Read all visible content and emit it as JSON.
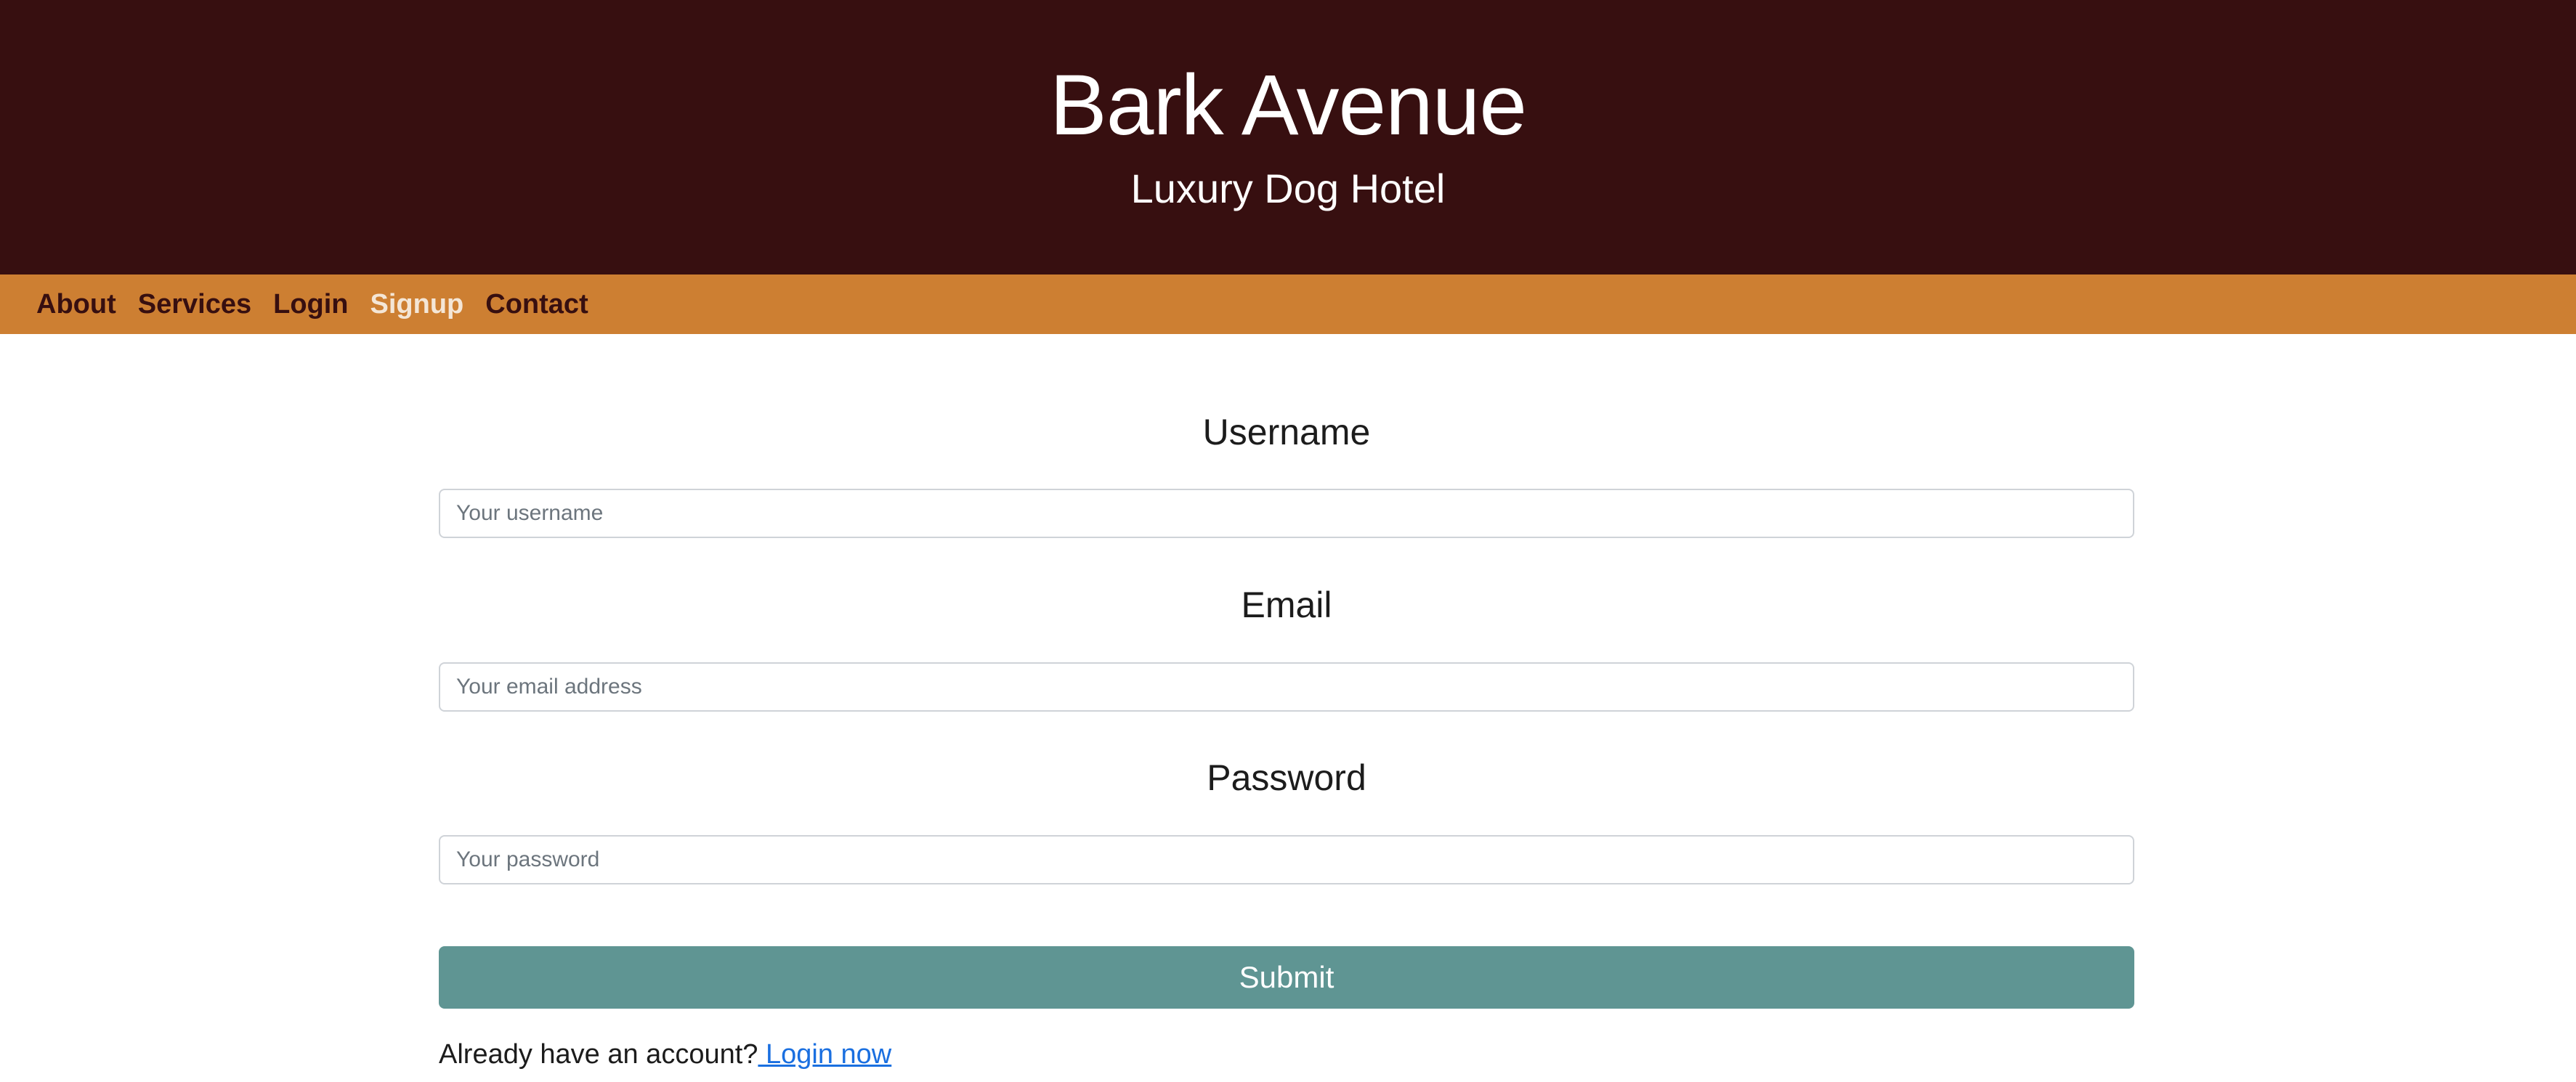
{
  "header": {
    "title": "Bark Avenue",
    "subtitle": "Luxury Dog Hotel"
  },
  "nav": {
    "items": [
      {
        "label": "About"
      },
      {
        "label": "Services"
      },
      {
        "label": "Login"
      },
      {
        "label": "Signup",
        "active": true
      },
      {
        "label": "Contact"
      }
    ]
  },
  "form": {
    "username": {
      "label": "Username",
      "placeholder": "Your username",
      "value": ""
    },
    "email": {
      "label": "Email",
      "placeholder": "Your email address",
      "value": ""
    },
    "password": {
      "label": "Password",
      "placeholder": "Your password",
      "value": ""
    },
    "submit_label": "Submit",
    "login_prompt": "Already have an account?",
    "login_link": " Login now"
  },
  "colors": {
    "header_bg": "#370f10",
    "nav_bg": "#cd7f32",
    "nav_active": "#f4e6d6",
    "submit_bg": "#5f9593",
    "link": "#1a6fe0"
  }
}
